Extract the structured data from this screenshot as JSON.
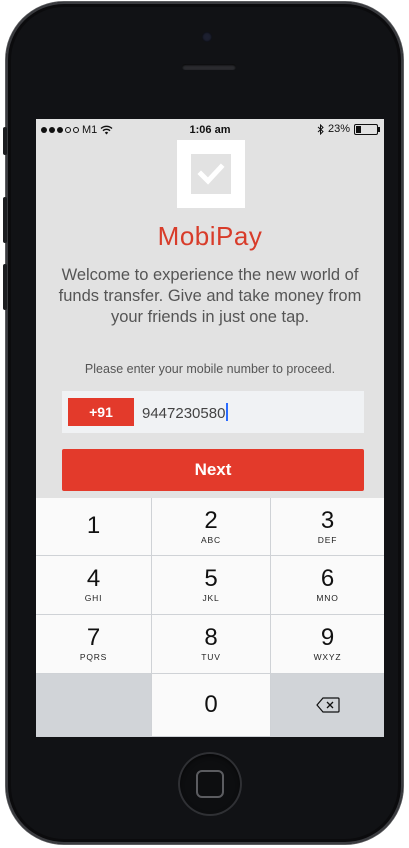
{
  "status_bar": {
    "carrier": "M1",
    "time": "1:06 am",
    "battery": "23%",
    "battery_level": 0.23
  },
  "app": {
    "name": "MobiPay",
    "welcome_text": "Welcome to experience the new world of funds transfer. Give and take money from your friends in just one tap.",
    "prompt": "Please enter your mobile number to proceed.",
    "country_code": "+91",
    "phone_number": "9447230580",
    "next_label": "Next"
  },
  "keypad": {
    "keys": [
      {
        "digit": "1",
        "letters": ""
      },
      {
        "digit": "2",
        "letters": "ABC"
      },
      {
        "digit": "3",
        "letters": "DEF"
      },
      {
        "digit": "4",
        "letters": "GHI"
      },
      {
        "digit": "5",
        "letters": "JKL"
      },
      {
        "digit": "6",
        "letters": "MNO"
      },
      {
        "digit": "7",
        "letters": "PQRS"
      },
      {
        "digit": "8",
        "letters": "TUV"
      },
      {
        "digit": "9",
        "letters": "WXYZ"
      },
      {
        "digit": "0",
        "letters": ""
      }
    ]
  },
  "colors": {
    "accent": "#e33a2b",
    "brand_text": "#d83c2a",
    "screen_background": "#e2e2e2"
  },
  "icons": [
    "wifi-icon",
    "bluetooth-icon",
    "battery-icon",
    "checkbox-logo-icon",
    "backspace-icon",
    "home-button-icon"
  ]
}
